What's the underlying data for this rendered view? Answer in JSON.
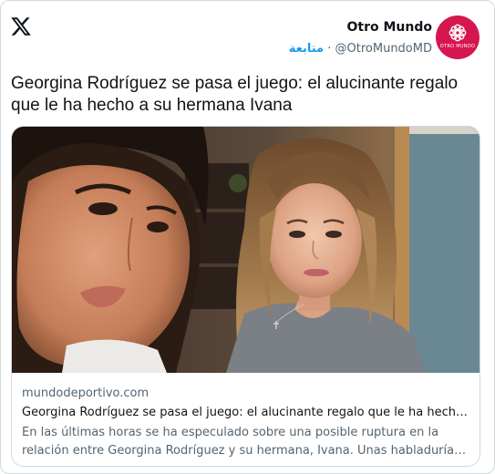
{
  "author": {
    "name": "Otro Mundo",
    "handle": "@OtroMundoMD",
    "separator": "·",
    "follow_label": "متابعة",
    "avatar_text": "OTRO MUNDO"
  },
  "tweet": {
    "text": "Georgina Rodríguez se pasa el juego: el alucinante regalo que le ha hecho a su hermana Ivana"
  },
  "link_card": {
    "domain": "mundodeportivo.com",
    "title": "Georgina Rodríguez se pasa el juego: el alucinante regalo que le ha hecho a su hermana Ivana",
    "description": "En las últimas horas se ha especulado sobre una posible ruptura en la relación entre Georgina Rodríguez y su hermana, Ivana. Unas habladurías que la propia Georgina ha desmentido"
  },
  "icons": {
    "platform_logo": "x-logo-icon",
    "avatar_emblem": "flower-emblem-icon"
  },
  "colors": {
    "accent": "#1d9bf0",
    "avatar_bg": "#d6164f",
    "text_primary": "#0f1419",
    "text_secondary": "#536471",
    "border": "#cfd9de"
  }
}
